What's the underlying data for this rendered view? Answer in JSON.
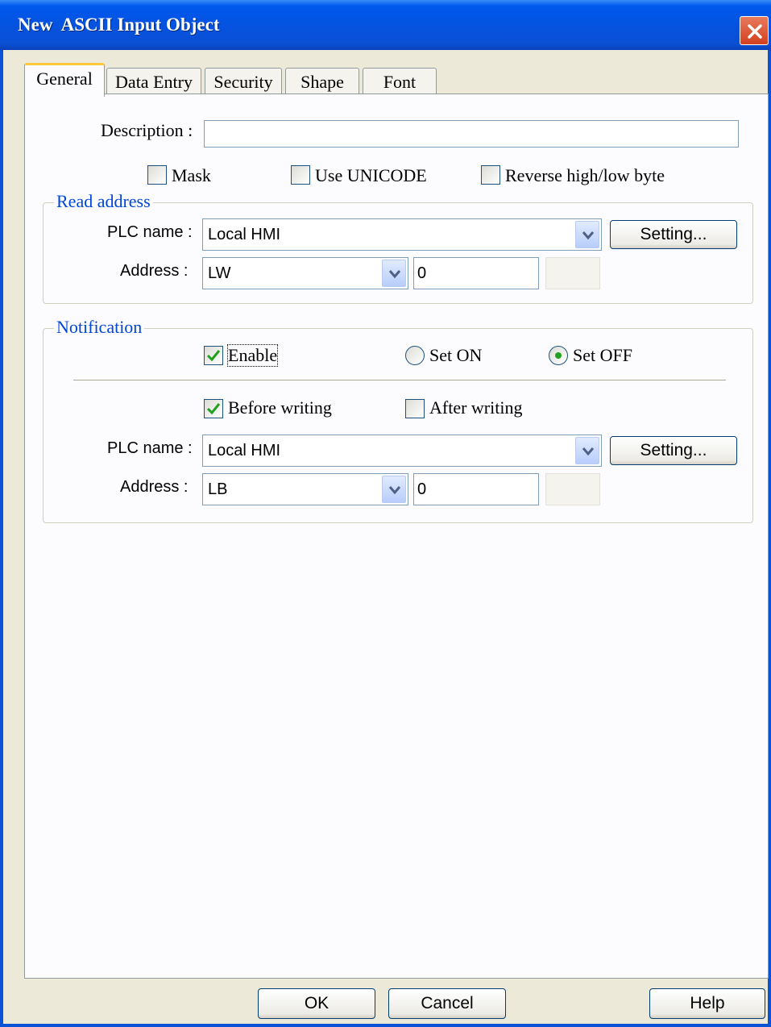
{
  "window": {
    "title": "New  ASCII Input Object"
  },
  "tabs": [
    {
      "label": "General",
      "active": true
    },
    {
      "label": "Data Entry",
      "active": false
    },
    {
      "label": "Security",
      "active": false
    },
    {
      "label": "Shape",
      "active": false
    },
    {
      "label": "Font",
      "active": false
    }
  ],
  "general": {
    "description_label": "Description :",
    "description_value": "",
    "mask_label": "Mask",
    "mask_checked": false,
    "unicode_label": "Use UNICODE",
    "unicode_checked": false,
    "reverse_label": "Reverse high/low byte",
    "reverse_checked": false
  },
  "read_address": {
    "group_title": "Read address",
    "plc_label": "PLC name :",
    "plc_value": "Local HMI",
    "setting_label": "Setting...",
    "address_label": "Address :",
    "address_device": "LW",
    "address_value": "0"
  },
  "notification": {
    "group_title": "Notification",
    "enable_label": "Enable",
    "enable_checked": true,
    "set_on_label": "Set ON",
    "set_off_label": "Set OFF",
    "selected_mode": "Set OFF",
    "before_label": "Before writing",
    "before_checked": true,
    "after_label": "After writing",
    "after_checked": false,
    "plc_label": "PLC name :",
    "plc_value": "Local HMI",
    "setting_label": "Setting...",
    "address_label": "Address :",
    "address_device": "LB",
    "address_value": "0"
  },
  "footer": {
    "ok_label": "OK",
    "cancel_label": "Cancel",
    "help_label": "Help"
  },
  "colors": {
    "titlebar": "#0553e0",
    "group_title": "#0046d5",
    "check_mark": "#21a121"
  }
}
